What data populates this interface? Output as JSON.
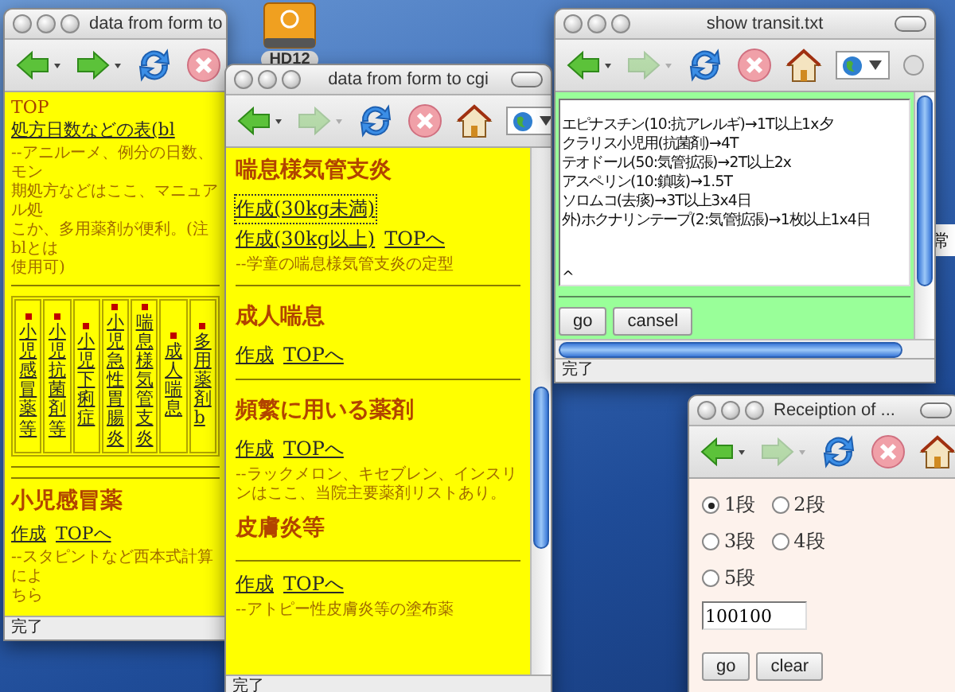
{
  "desktop": {
    "drive_label": "HD12",
    "background_window_text": "常"
  },
  "cgi_window_back": {
    "title": "data from form to",
    "forward_enabled": true,
    "status": "完了",
    "blocks": [
      {
        "kind": "link_row",
        "items": [
          {
            "text": "TOP",
            "link": false,
            "focused": false
          },
          {
            "text": "処方日数などの表(bl",
            "link": true,
            "focused": false
          }
        ]
      },
      {
        "kind": "note",
        "lines": [
          "--アニルーメ、例分の日数、モン",
          "期処方などはここ、マニュアル処",
          "こか、多用薬剤が便利。(注blとは",
          "使用可)"
        ]
      },
      {
        "kind": "rule"
      },
      {
        "kind": "columns",
        "items": [
          "小児感冒薬等",
          "小児抗菌剤等",
          "小児下痢症",
          "小児急性胃腸炎",
          "喘息様気管支炎",
          "成人喘息",
          "多用薬剤b"
        ]
      },
      {
        "kind": "rule"
      },
      {
        "kind": "rule"
      },
      {
        "kind": "heading",
        "text": "小児感冒薬"
      },
      {
        "kind": "link_row",
        "items": [
          {
            "text": "作成",
            "link": true,
            "focused": false
          },
          {
            "text": "TOPへ",
            "link": true,
            "focused": false
          }
        ]
      },
      {
        "kind": "note",
        "lines": [
          "--スタピントなど西本式計算によ",
          "ちら"
        ]
      }
    ]
  },
  "cgi_window_front": {
    "title": "data from form to cgi",
    "forward_enabled": false,
    "status": "完了",
    "blocks": [
      {
        "kind": "heading",
        "text": "喘息様気管支炎"
      },
      {
        "kind": "link_row",
        "items": [
          {
            "text": "作成(30kg未満)",
            "link": true,
            "focused": true
          }
        ]
      },
      {
        "kind": "link_row",
        "items": [
          {
            "text": "作成(30kg以上)",
            "link": true,
            "focused": false
          },
          {
            "text": "TOPへ",
            "link": true,
            "focused": false
          }
        ]
      },
      {
        "kind": "note",
        "lines": [
          "--学童の喘息様気管支炎の定型"
        ]
      },
      {
        "kind": "rule"
      },
      {
        "kind": "heading",
        "text": "成人喘息"
      },
      {
        "kind": "link_row",
        "items": [
          {
            "text": "作成",
            "link": true,
            "focused": false
          },
          {
            "text": "TOPへ",
            "link": true,
            "focused": false
          }
        ]
      },
      {
        "kind": "rule"
      },
      {
        "kind": "heading",
        "text": "頻繁に用いる薬剤"
      },
      {
        "kind": "link_row",
        "items": [
          {
            "text": "作成",
            "link": true,
            "focused": false
          },
          {
            "text": "TOPへ",
            "link": true,
            "focused": false
          }
        ]
      },
      {
        "kind": "note",
        "lines": [
          "--ラックメロン、キセブレン、インスリンはここ、当院主要薬剤リストあり。"
        ]
      },
      {
        "kind": "heading",
        "text": "皮膚炎等"
      },
      {
        "kind": "rule"
      },
      {
        "kind": "link_row",
        "items": [
          {
            "text": "作成",
            "link": true,
            "focused": false
          },
          {
            "text": "TOPへ",
            "link": true,
            "focused": false
          }
        ]
      },
      {
        "kind": "note",
        "lines": [
          "--アトピー性皮膚炎等の塗布薬"
        ]
      }
    ]
  },
  "transit_window": {
    "title": "show transit.txt",
    "forward_enabled": false,
    "status": "完了",
    "text_lines": [
      "エピナスチン(10:抗アレルギ)→1T以上1x夕",
      "クラリス小児用(抗菌剤)→4T",
      "テオドール(50:気管拡張)→2T以上2x",
      "アスペリン(10:鎮咳)→1.5T",
      "ソロムコ(去痰)→3T以上3x4日",
      "外)ホクナリンテープ(2:気管拡張)→1枚以上1x4日"
    ],
    "trailing_text": "^",
    "buttons": [
      "go",
      "cansel"
    ]
  },
  "reception_window": {
    "title": "Receiption of ...",
    "forward_enabled": false,
    "options": [
      {
        "label": "1段",
        "selected": true
      },
      {
        "label": "2段",
        "selected": false
      },
      {
        "label": "3段",
        "selected": false
      },
      {
        "label": "4段",
        "selected": false
      },
      {
        "label": "5段",
        "selected": false
      }
    ],
    "input_value": "100100",
    "buttons": [
      "go",
      "clear"
    ]
  }
}
